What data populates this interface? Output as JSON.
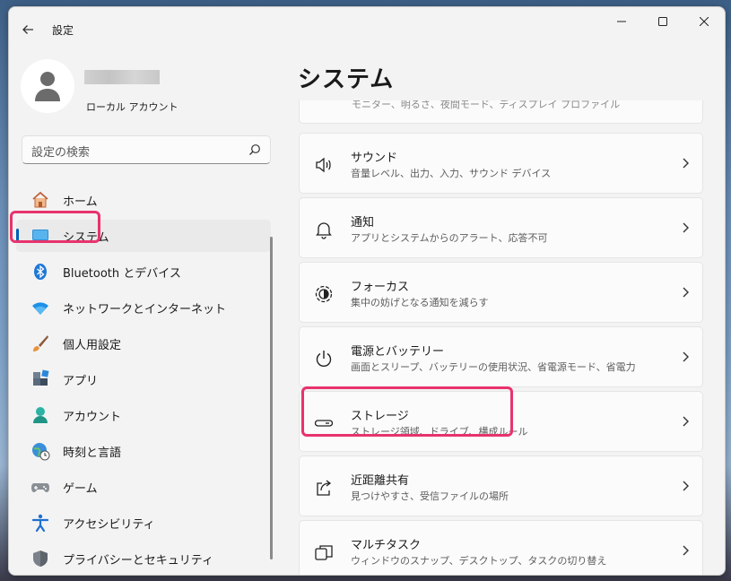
{
  "window": {
    "title": "設定"
  },
  "profile": {
    "account_type": "ローカル アカウント"
  },
  "search": {
    "placeholder": "設定の検索"
  },
  "sidebar": {
    "items": [
      {
        "label": "ホーム",
        "icon": "home-icon"
      },
      {
        "label": "システム",
        "icon": "monitor-icon",
        "active": true
      },
      {
        "label": "Bluetooth とデバイス",
        "icon": "bluetooth-icon"
      },
      {
        "label": "ネットワークとインターネット",
        "icon": "wifi-icon"
      },
      {
        "label": "個人用設定",
        "icon": "paintbrush-icon"
      },
      {
        "label": "アプリ",
        "icon": "apps-icon"
      },
      {
        "label": "アカウント",
        "icon": "person-icon"
      },
      {
        "label": "時刻と言語",
        "icon": "globe-clock-icon"
      },
      {
        "label": "ゲーム",
        "icon": "gamepad-icon"
      },
      {
        "label": "アクセシビリティ",
        "icon": "accessibility-icon"
      },
      {
        "label": "プライバシーとセキュリティ",
        "icon": "shield-icon"
      }
    ]
  },
  "main": {
    "title": "システム",
    "cut_card_text": "モニター、明るさ、夜間モード、ディスプレイ プロファイル",
    "cards": [
      {
        "title": "サウンド",
        "subtitle": "音量レベル、出力、入力、サウンド デバイス",
        "icon": "speaker-icon"
      },
      {
        "title": "通知",
        "subtitle": "アプリとシステムからのアラート、応答不可",
        "icon": "bell-icon"
      },
      {
        "title": "フォーカス",
        "subtitle": "集中の妨げとなる通知を減らす",
        "icon": "focus-icon"
      },
      {
        "title": "電源とバッテリー",
        "subtitle": "画面とスリープ、バッテリーの使用状況、省電源モード、省電力",
        "icon": "power-icon"
      },
      {
        "title": "ストレージ",
        "subtitle": "ストレージ領域、ドライブ、構成ルール",
        "icon": "storage-icon"
      },
      {
        "title": "近距離共有",
        "subtitle": "見つけやすさ、受信ファイルの場所",
        "icon": "share-icon"
      },
      {
        "title": "マルチタスク",
        "subtitle": "ウィンドウのスナップ、デスクトップ、タスクの切り替え",
        "icon": "multitask-icon"
      }
    ]
  },
  "colors": {
    "accent": "#005fb8",
    "highlight": "#e8336d",
    "background": "#f3f3f3",
    "card": "#fbfbfb"
  }
}
